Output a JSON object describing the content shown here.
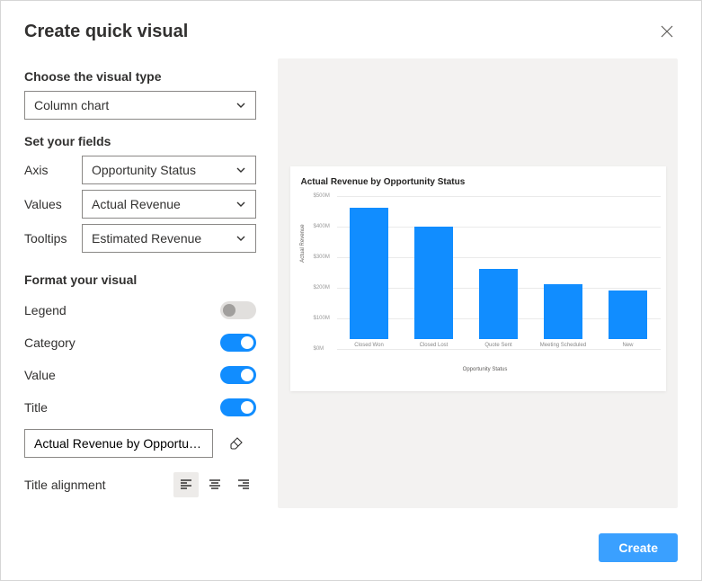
{
  "dialog_title": "Create quick visual",
  "visual_type": {
    "label": "Choose the visual type",
    "value": "Column chart"
  },
  "fields": {
    "label": "Set your fields",
    "rows": [
      {
        "label": "Axis",
        "value": "Opportunity Status"
      },
      {
        "label": "Values",
        "value": "Actual Revenue"
      },
      {
        "label": "Tooltips",
        "value": "Estimated Revenue"
      }
    ]
  },
  "format": {
    "label": "Format your visual",
    "legend": {
      "label": "Legend",
      "on": false
    },
    "category": {
      "label": "Category",
      "on": true
    },
    "value": {
      "label": "Value",
      "on": true
    },
    "title": {
      "label": "Title",
      "on": true
    },
    "title_text": "Actual Revenue by Opportunity Status",
    "alignment_label": "Title alignment",
    "alignment": "left"
  },
  "chart_data": {
    "type": "bar",
    "title": "Actual Revenue by Opportunity Status",
    "xlabel": "Opportunity Status",
    "ylabel": "Actual Revenue",
    "categories": [
      "Closed Won",
      "Closed Lost",
      "Quote Sent",
      "Meeting Scheduled",
      "New"
    ],
    "values": [
      430,
      370,
      230,
      180,
      160
    ],
    "ylim": [
      0,
      500
    ],
    "y_ticks": [
      "$0M",
      "$100M",
      "$200M",
      "$300M",
      "$400M",
      "$500M"
    ]
  },
  "create_button": "Create"
}
